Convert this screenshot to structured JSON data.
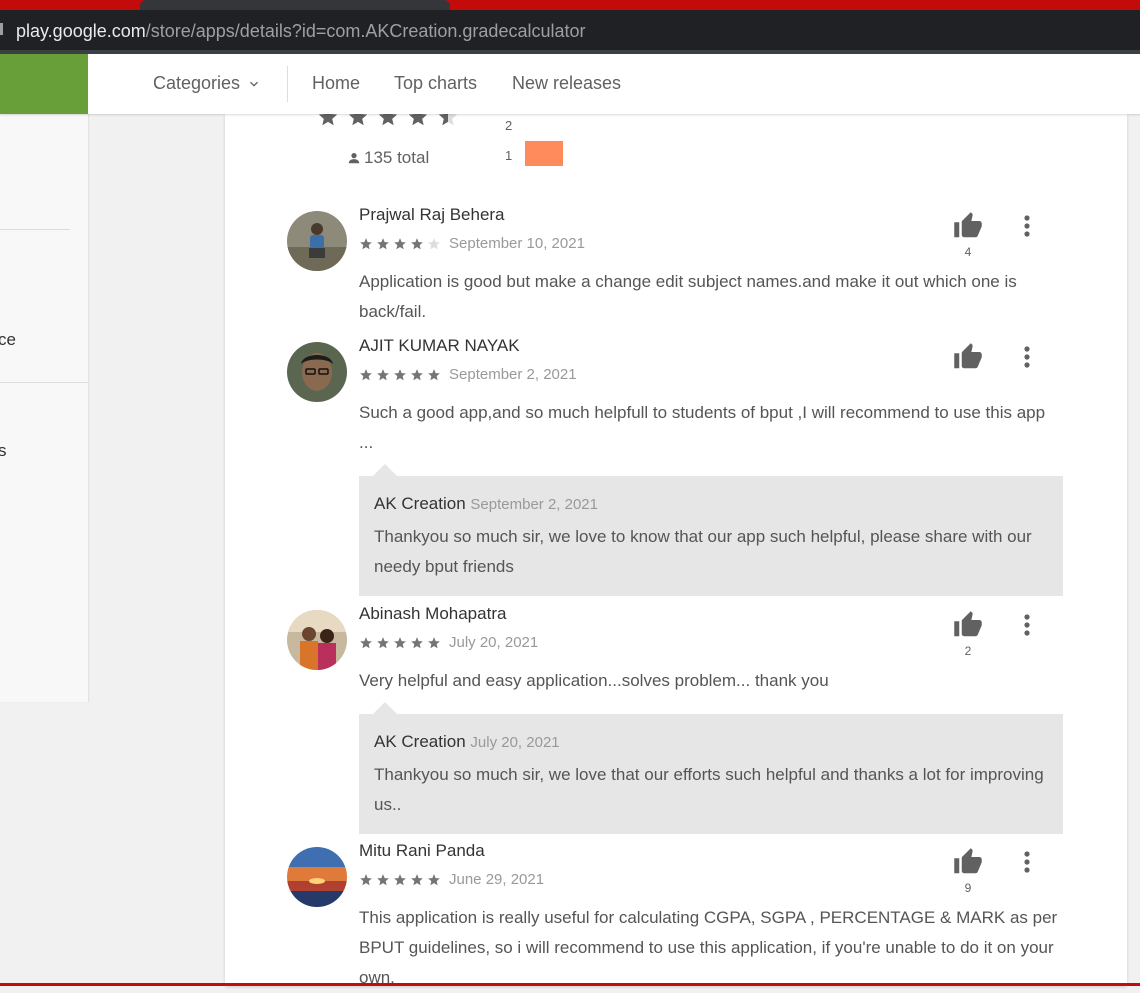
{
  "browser": {
    "url_host": "play.google.com",
    "url_path": "/store/apps/details?id=com.AKCreation.gradecalculator"
  },
  "header": {
    "categories_label": "Categories",
    "nav": [
      "Home",
      "Top charts",
      "New releases"
    ]
  },
  "sidebar": {
    "fragments": [
      "ce",
      "s"
    ]
  },
  "ratings_summary": {
    "stars": 4.5,
    "total": "135 total",
    "histogram_labels": [
      "2",
      "1"
    ]
  },
  "reviews": [
    {
      "author": "Prajwal Raj Behera",
      "rating": 4,
      "date": "September 10, 2021",
      "text": "Application is good but make a change edit subject names.and make it out which one is back/fail.",
      "helpful_count": "4"
    },
    {
      "author": "AJIT KUMAR NAYAK",
      "rating": 5,
      "date": "September 2, 2021",
      "text": "Such a good app,and so much helpfull to students of bput ,I will recommend to use this app ...",
      "helpful_count": "",
      "reply": {
        "author": "AK Creation",
        "date": "September 2, 2021",
        "text": "Thankyou so much sir, we love to know that our app such helpful, please share with our needy bput friends"
      }
    },
    {
      "author": "Abinash Mohapatra",
      "rating": 5,
      "date": "July 20, 2021",
      "text": "Very helpful and easy application...solves problem... thank you",
      "helpful_count": "2",
      "reply": {
        "author": "AK Creation",
        "date": "July 20, 2021",
        "text": "Thankyou so much sir, we love that our efforts such helpful and thanks a lot for improving us.."
      }
    },
    {
      "author": "Mitu Rani Panda",
      "rating": 5,
      "date": "June 29, 2021",
      "text": "This application is really useful for calculating CGPA, SGPA , PERCENTAGE & MARK as per BPUT guidelines, so i will recommend to use this application, if you're unable to do it on your own.",
      "helpful_count": "9"
    }
  ],
  "colors": {
    "brand_green": "#689f38",
    "histogram_bar": "#ff8a5c",
    "reply_bg": "#e6e6e6"
  }
}
